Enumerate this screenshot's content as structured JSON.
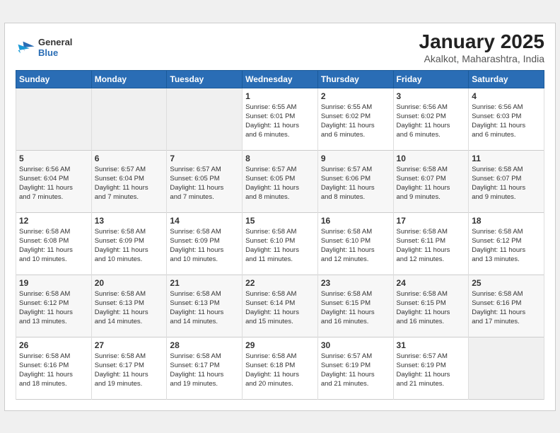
{
  "header": {
    "logo_line1": "General",
    "logo_line2": "Blue",
    "title": "January 2025",
    "subtitle": "Akalkot, Maharashtra, India"
  },
  "days_header": [
    "Sunday",
    "Monday",
    "Tuesday",
    "Wednesday",
    "Thursday",
    "Friday",
    "Saturday"
  ],
  "weeks": [
    [
      {
        "num": "",
        "info": ""
      },
      {
        "num": "",
        "info": ""
      },
      {
        "num": "",
        "info": ""
      },
      {
        "num": "1",
        "info": "Sunrise: 6:55 AM\nSunset: 6:01 PM\nDaylight: 11 hours\nand 6 minutes."
      },
      {
        "num": "2",
        "info": "Sunrise: 6:55 AM\nSunset: 6:02 PM\nDaylight: 11 hours\nand 6 minutes."
      },
      {
        "num": "3",
        "info": "Sunrise: 6:56 AM\nSunset: 6:02 PM\nDaylight: 11 hours\nand 6 minutes."
      },
      {
        "num": "4",
        "info": "Sunrise: 6:56 AM\nSunset: 6:03 PM\nDaylight: 11 hours\nand 6 minutes."
      }
    ],
    [
      {
        "num": "5",
        "info": "Sunrise: 6:56 AM\nSunset: 6:04 PM\nDaylight: 11 hours\nand 7 minutes."
      },
      {
        "num": "6",
        "info": "Sunrise: 6:57 AM\nSunset: 6:04 PM\nDaylight: 11 hours\nand 7 minutes."
      },
      {
        "num": "7",
        "info": "Sunrise: 6:57 AM\nSunset: 6:05 PM\nDaylight: 11 hours\nand 7 minutes."
      },
      {
        "num": "8",
        "info": "Sunrise: 6:57 AM\nSunset: 6:05 PM\nDaylight: 11 hours\nand 8 minutes."
      },
      {
        "num": "9",
        "info": "Sunrise: 6:57 AM\nSunset: 6:06 PM\nDaylight: 11 hours\nand 8 minutes."
      },
      {
        "num": "10",
        "info": "Sunrise: 6:58 AM\nSunset: 6:07 PM\nDaylight: 11 hours\nand 9 minutes."
      },
      {
        "num": "11",
        "info": "Sunrise: 6:58 AM\nSunset: 6:07 PM\nDaylight: 11 hours\nand 9 minutes."
      }
    ],
    [
      {
        "num": "12",
        "info": "Sunrise: 6:58 AM\nSunset: 6:08 PM\nDaylight: 11 hours\nand 10 minutes."
      },
      {
        "num": "13",
        "info": "Sunrise: 6:58 AM\nSunset: 6:09 PM\nDaylight: 11 hours\nand 10 minutes."
      },
      {
        "num": "14",
        "info": "Sunrise: 6:58 AM\nSunset: 6:09 PM\nDaylight: 11 hours\nand 10 minutes."
      },
      {
        "num": "15",
        "info": "Sunrise: 6:58 AM\nSunset: 6:10 PM\nDaylight: 11 hours\nand 11 minutes."
      },
      {
        "num": "16",
        "info": "Sunrise: 6:58 AM\nSunset: 6:10 PM\nDaylight: 11 hours\nand 12 minutes."
      },
      {
        "num": "17",
        "info": "Sunrise: 6:58 AM\nSunset: 6:11 PM\nDaylight: 11 hours\nand 12 minutes."
      },
      {
        "num": "18",
        "info": "Sunrise: 6:58 AM\nSunset: 6:12 PM\nDaylight: 11 hours\nand 13 minutes."
      }
    ],
    [
      {
        "num": "19",
        "info": "Sunrise: 6:58 AM\nSunset: 6:12 PM\nDaylight: 11 hours\nand 13 minutes."
      },
      {
        "num": "20",
        "info": "Sunrise: 6:58 AM\nSunset: 6:13 PM\nDaylight: 11 hours\nand 14 minutes."
      },
      {
        "num": "21",
        "info": "Sunrise: 6:58 AM\nSunset: 6:13 PM\nDaylight: 11 hours\nand 14 minutes."
      },
      {
        "num": "22",
        "info": "Sunrise: 6:58 AM\nSunset: 6:14 PM\nDaylight: 11 hours\nand 15 minutes."
      },
      {
        "num": "23",
        "info": "Sunrise: 6:58 AM\nSunset: 6:15 PM\nDaylight: 11 hours\nand 16 minutes."
      },
      {
        "num": "24",
        "info": "Sunrise: 6:58 AM\nSunset: 6:15 PM\nDaylight: 11 hours\nand 16 minutes."
      },
      {
        "num": "25",
        "info": "Sunrise: 6:58 AM\nSunset: 6:16 PM\nDaylight: 11 hours\nand 17 minutes."
      }
    ],
    [
      {
        "num": "26",
        "info": "Sunrise: 6:58 AM\nSunset: 6:16 PM\nDaylight: 11 hours\nand 18 minutes."
      },
      {
        "num": "27",
        "info": "Sunrise: 6:58 AM\nSunset: 6:17 PM\nDaylight: 11 hours\nand 19 minutes."
      },
      {
        "num": "28",
        "info": "Sunrise: 6:58 AM\nSunset: 6:17 PM\nDaylight: 11 hours\nand 19 minutes."
      },
      {
        "num": "29",
        "info": "Sunrise: 6:58 AM\nSunset: 6:18 PM\nDaylight: 11 hours\nand 20 minutes."
      },
      {
        "num": "30",
        "info": "Sunrise: 6:57 AM\nSunset: 6:19 PM\nDaylight: 11 hours\nand 21 minutes."
      },
      {
        "num": "31",
        "info": "Sunrise: 6:57 AM\nSunset: 6:19 PM\nDaylight: 11 hours\nand 21 minutes."
      },
      {
        "num": "",
        "info": ""
      }
    ]
  ]
}
